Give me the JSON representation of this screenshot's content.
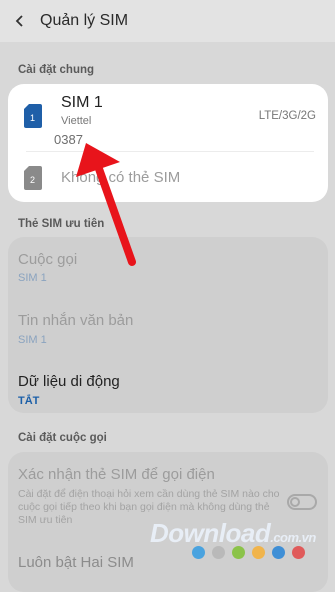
{
  "header": {
    "title": "Quản lý SIM"
  },
  "general": {
    "section_label": "Cài đặt chung",
    "sim1": {
      "name": "SIM 1",
      "carrier": "Viettel",
      "number": "0387",
      "network": "LTE/3G/2G",
      "badge": "1"
    },
    "sim2": {
      "label": "Không có thẻ SIM",
      "badge": "2"
    }
  },
  "preferred": {
    "section_label": "Thẻ SIM ưu tiên",
    "calls": {
      "label": "Cuộc gọi",
      "value": "SIM 1"
    },
    "messages": {
      "label": "Tin nhắn văn bản",
      "value": "SIM 1"
    },
    "data": {
      "label": "Dữ liệu di động",
      "value": "TẮT"
    }
  },
  "call_settings": {
    "section_label": "Cài đặt cuộc gọi",
    "confirm": {
      "label": "Xác nhận thẻ SIM để gọi điện",
      "description": "Cài đặt để điện thoại hỏi xem cần dùng thẻ SIM nào cho cuộc gọi tiếp theo khi bạn gọi điện mà không dùng thẻ SIM ưu tiên",
      "enabled": false
    },
    "dual": {
      "label": "Luôn bật Hai SIM"
    }
  },
  "watermark": {
    "text": "Download",
    "suffix": ".com.vn"
  },
  "colors": {
    "sim_active": "#1f5fa8",
    "sim_inactive": "#8a8a8a",
    "arrow": "#e8141b"
  }
}
